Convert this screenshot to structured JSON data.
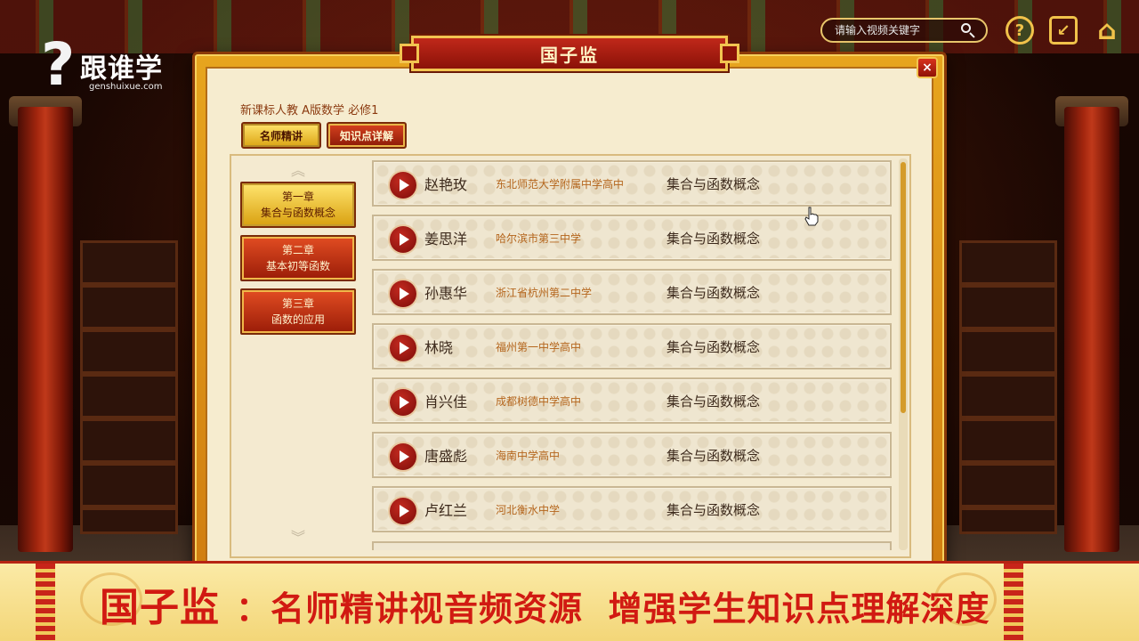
{
  "logo": {
    "mark": "?",
    "name": "跟谁学",
    "sub": "genshuixue.com"
  },
  "search": {
    "placeholder": "请输入视频关键字",
    "value": ""
  },
  "top_buttons": {
    "help": "?",
    "back": "↙",
    "home": "⌂"
  },
  "dialog": {
    "title": "国子监",
    "close_label": "×",
    "course_title": "新课标人教 A版数学 必修1",
    "tabs": [
      {
        "label": "名师精讲",
        "active": true
      },
      {
        "label": "知识点详解",
        "active": false
      }
    ],
    "chapters": [
      {
        "line1": "第一章",
        "line2": "集合与函数概念",
        "active": true
      },
      {
        "line1": "第二章",
        "line2": "基本初等函数",
        "active": false
      },
      {
        "line1": "第三章",
        "line2": "函数的应用",
        "active": false
      }
    ],
    "scroll_up": "︽",
    "scroll_down": "︾",
    "videos": [
      {
        "teacher": "赵艳玫",
        "school": "东北师范大学附属中学高中",
        "topic": "集合与函数概念"
      },
      {
        "teacher": "姜思洋",
        "school": "哈尔滨市第三中学",
        "topic": "集合与函数概念"
      },
      {
        "teacher": "孙惠华",
        "school": "浙江省杭州第二中学",
        "topic": "集合与函数概念"
      },
      {
        "teacher": "林晓",
        "school": "福州第一中学高中",
        "topic": "集合与函数概念"
      },
      {
        "teacher": "肖兴佳",
        "school": "成都树德中学高中",
        "topic": "集合与函数概念"
      },
      {
        "teacher": "唐盛彪",
        "school": "海南中学高中",
        "topic": "集合与函数概念"
      },
      {
        "teacher": "卢红兰",
        "school": "河北衡水中学",
        "topic": "集合与函数概念"
      }
    ]
  },
  "banner": {
    "brand": "国子监",
    "colon": "：",
    "text": "名师精讲视音频资源  增强学生知识点理解深度"
  },
  "colors": {
    "accent": "#f2c450",
    "title_red": "#c0281a",
    "banner_text": "#d11a12"
  }
}
